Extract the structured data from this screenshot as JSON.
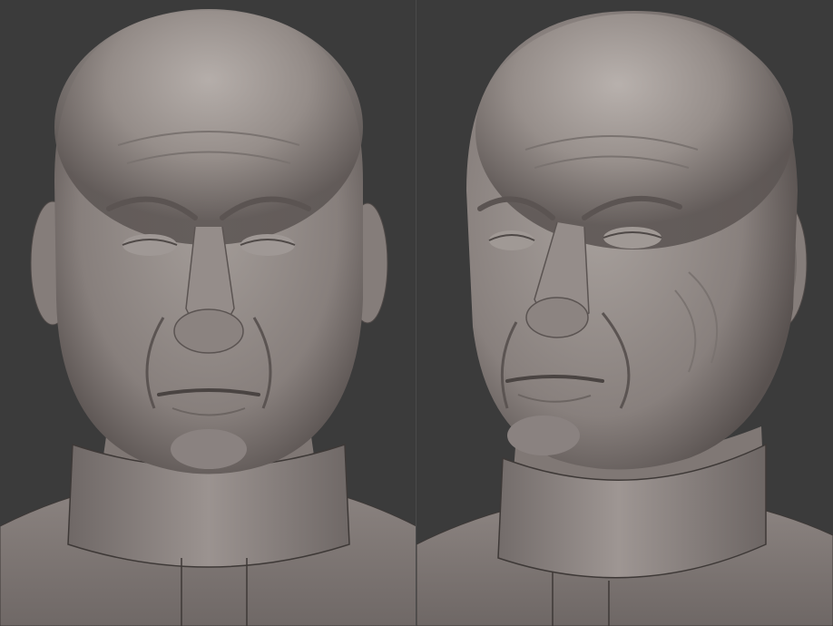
{
  "image": {
    "description_labels": [],
    "background_color": "#3b3b3b",
    "clay_color": "#8e8683",
    "clay_shadow": "#5a5452",
    "clay_highlight": "#b8b2ae"
  },
  "views": [
    {
      "name": "front-view"
    },
    {
      "name": "three-quarter-view"
    }
  ]
}
